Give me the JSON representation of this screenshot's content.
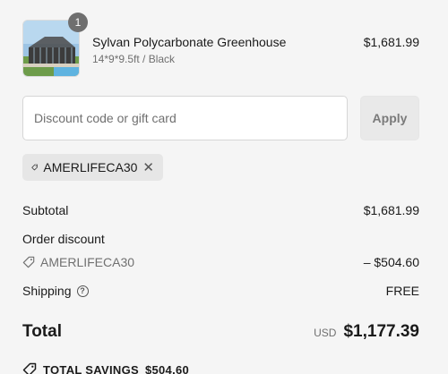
{
  "product": {
    "quantity": "1",
    "name": "Sylvan Polycarbonate Greenhouse",
    "variant": "14*9*9.5ft / Black",
    "price": "$1,681.99"
  },
  "discount": {
    "placeholder": "Discount code or gift card",
    "value": "",
    "apply_label": "Apply",
    "applied_code": "AMERLIFECA30"
  },
  "summary": {
    "subtotal_label": "Subtotal",
    "subtotal_value": "$1,681.99",
    "order_discount_label": "Order discount",
    "discount_code": "AMERLIFECA30",
    "discount_value": "– $504.60",
    "shipping_label": "Shipping",
    "shipping_value": "FREE",
    "total_label": "Total",
    "currency": "USD",
    "total_value": "$1,177.39",
    "savings_label": "TOTAL SAVINGS",
    "savings_value": "$504.60"
  },
  "icons": {
    "tag": "tag-icon",
    "close": "close-icon",
    "help": "question-circle-icon"
  },
  "colors": {
    "background": "#f5f5f5",
    "badge": "#6f6f6f",
    "muted_text": "#707070"
  }
}
